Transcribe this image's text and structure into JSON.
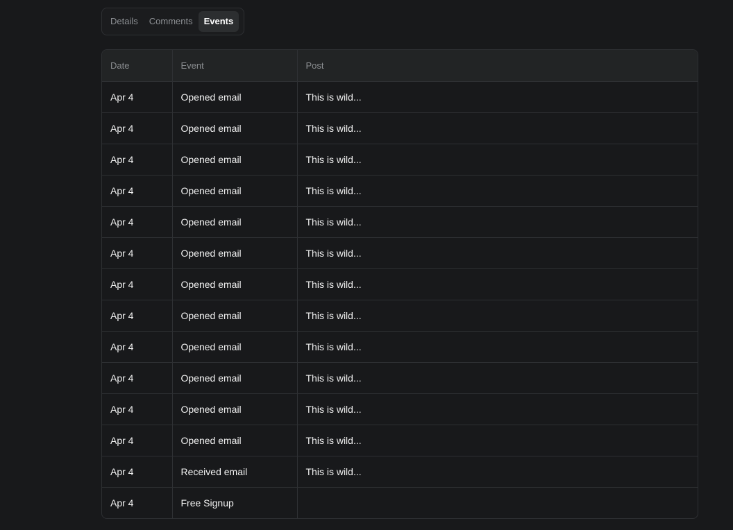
{
  "tabs": [
    {
      "label": "Details",
      "active": false
    },
    {
      "label": "Comments",
      "active": false
    },
    {
      "label": "Events",
      "active": true
    }
  ],
  "table": {
    "columns": [
      "Date",
      "Event",
      "Post"
    ],
    "rows": [
      [
        "Apr 4",
        "Opened email",
        "This is wild..."
      ],
      [
        "Apr 4",
        "Opened email",
        "This is wild..."
      ],
      [
        "Apr 4",
        "Opened email",
        "This is wild..."
      ],
      [
        "Apr 4",
        "Opened email",
        "This is wild..."
      ],
      [
        "Apr 4",
        "Opened email",
        "This is wild..."
      ],
      [
        "Apr 4",
        "Opened email",
        "This is wild..."
      ],
      [
        "Apr 4",
        "Opened email",
        "This is wild..."
      ],
      [
        "Apr 4",
        "Opened email",
        "This is wild..."
      ],
      [
        "Apr 4",
        "Opened email",
        "This is wild..."
      ],
      [
        "Apr 4",
        "Opened email",
        "This is wild..."
      ],
      [
        "Apr 4",
        "Opened email",
        "This is wild..."
      ],
      [
        "Apr 4",
        "Opened email",
        "This is wild..."
      ],
      [
        "Apr 4",
        "Received email",
        "This is wild..."
      ],
      [
        "Apr 4",
        "Free Signup",
        ""
      ]
    ]
  }
}
